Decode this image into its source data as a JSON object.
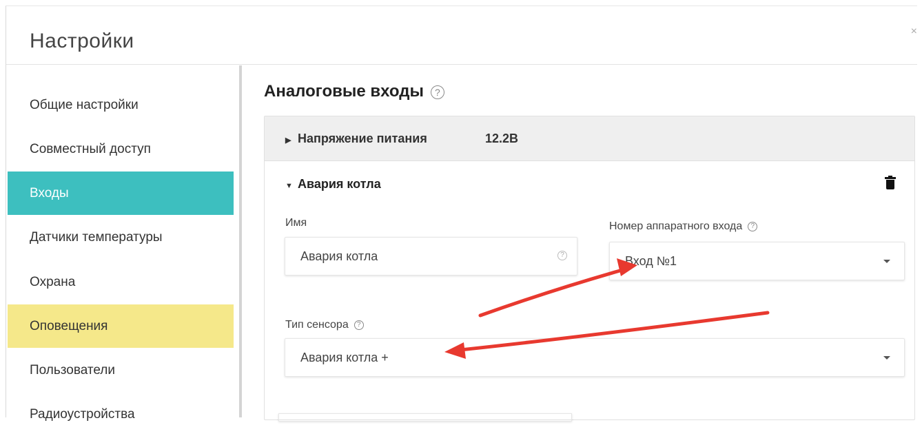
{
  "window": {
    "title": "Настройки",
    "close_glyph": "×"
  },
  "sidebar": {
    "items": [
      {
        "label": "Общие настройки",
        "state": "normal"
      },
      {
        "label": "Совместный доступ",
        "state": "normal"
      },
      {
        "label": "Входы",
        "state": "active"
      },
      {
        "label": "Датчики температуры",
        "state": "normal"
      },
      {
        "label": "Охрана",
        "state": "normal"
      },
      {
        "label": "Оповещения",
        "state": "highlighted"
      },
      {
        "label": "Пользователи",
        "state": "normal"
      },
      {
        "label": "Радиоустройства",
        "state": "normal"
      }
    ]
  },
  "main": {
    "title": "Аналоговые входы",
    "help_glyph": "?",
    "collapsed_row": {
      "caret": "▶",
      "label": "Напряжение питания",
      "value": "12.2В"
    },
    "expanded": {
      "caret": "▼",
      "label": "Авария котла",
      "delete_icon": "trash-icon",
      "name_field": {
        "label": "Имя",
        "value": "Авария котла"
      },
      "hw_input": {
        "label": "Номер аппаратного входа",
        "value": "Вход №1"
      },
      "sensor_type": {
        "label": "Тип сенсора",
        "value": "Авария котла +"
      }
    }
  },
  "colors": {
    "active": "#3dbfbf",
    "highlight": "#f5e88a",
    "annotation": "#e8392f"
  }
}
